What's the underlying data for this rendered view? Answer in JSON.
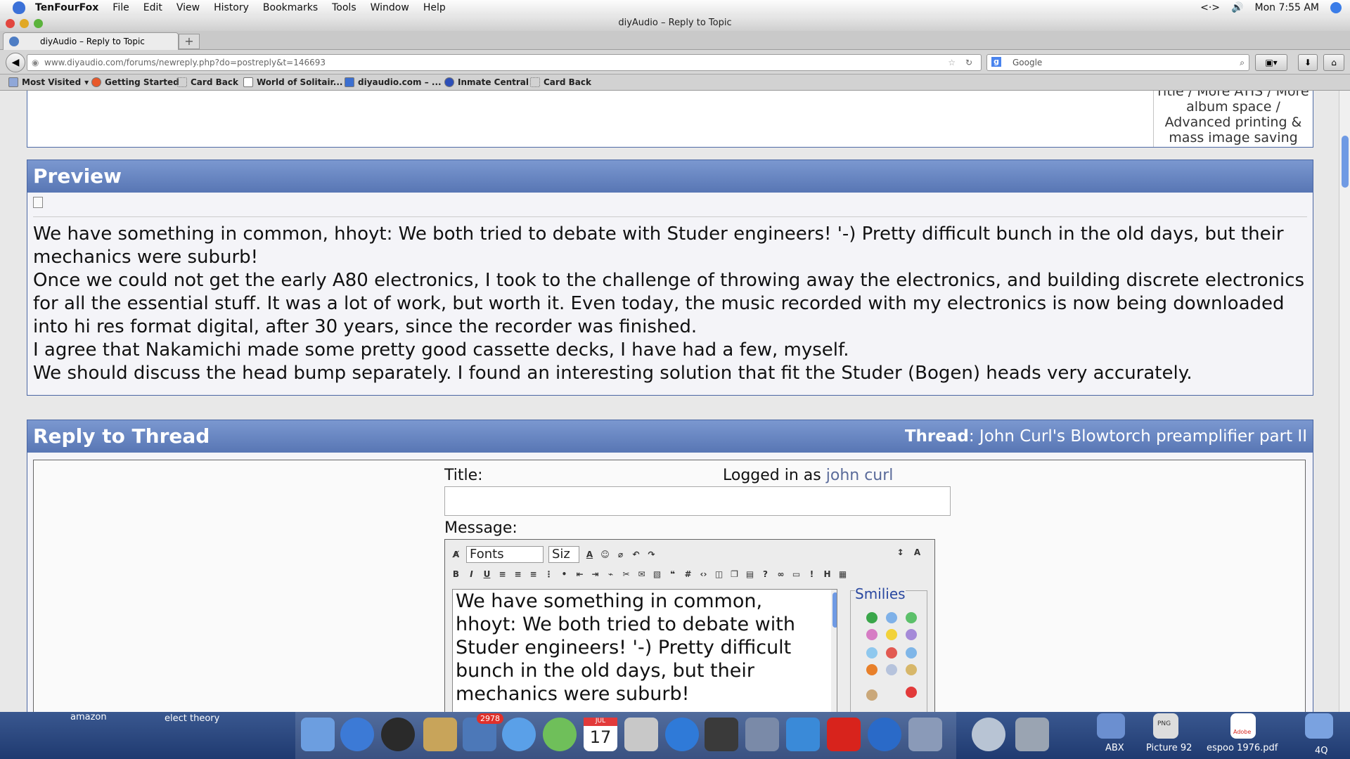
{
  "menubar": {
    "app": "TenFourFox",
    "items": [
      "File",
      "Edit",
      "View",
      "History",
      "Bookmarks",
      "Tools",
      "Window",
      "Help"
    ],
    "right_symbol": "<·>",
    "clock": "Mon 7:55 AM"
  },
  "window": {
    "title": "diyAudio – Reply to Topic"
  },
  "tabs": [
    {
      "label": "diyAudio – Reply to Topic"
    }
  ],
  "newtab_label": "+",
  "nav": {
    "url": "www.diyaudio.com/forums/newreply.php?do=postreply&t=146693",
    "search_placeholder": "Google"
  },
  "bookmarks": [
    "Most Visited",
    "Getting Started",
    "Card Back",
    "World of Solitair...",
    "diyaudio.com – ...",
    "Inmate Central",
    "Card Back"
  ],
  "ad_box": {
    "lines": [
      "ritle / More ATIS / More",
      "album space /",
      "Advanced printing &",
      "mass image saving"
    ]
  },
  "preview": {
    "heading": "Preview",
    "paragraphs": [
      "We have something in common, hhoyt: We both tried to debate with Studer engineers! '-) Pretty difficult bunch in the old days, but their mechanics were suburb!",
      "Once we could not get the early A80 electronics, I took to the challenge of throwing away the electronics, and building discrete electronics for all the essential stuff. It was a lot of work, but worth it. Even today, the music recorded with my electronics is now being downloaded into hi res format digital, after 30 years, since the recorder was finished.",
      "I agree that Nakamichi made some pretty good cassette decks, I have had a few, myself.",
      "We should discuss the head bump separately. I found an interesting solution that fit the Studer (Bogen) heads very accurately."
    ]
  },
  "reply": {
    "heading": "Reply to Thread",
    "thread_label": "Thread",
    "thread_sep": ":",
    "thread_name": "John Curl's Blowtorch preamplifier part II",
    "title_label": "Title:",
    "logged_in_label": "Logged in as",
    "user": "john curl",
    "message_label": "Message:",
    "font_select": "Fonts",
    "size_select": "Siz",
    "smilies_label": "Smilies",
    "message_lines": [
      "We have something in common,",
      "hhoyt:  We both tried to debate with",
      "Studer engineers! '-)    Pretty difficult",
      "bunch in the old days, but their",
      "mechanics were suburb!"
    ]
  },
  "dock": {
    "left_labels": [
      "amazon",
      "elect theory"
    ],
    "mail_badge": "2978",
    "calendar_day": "17",
    "calendar_month": "JUL",
    "right_items": [
      "ABX",
      "Picture 92",
      "espoo 1976.pdf",
      "4Q"
    ],
    "png_text": "PNG",
    "adobe_text": "Adobe"
  }
}
